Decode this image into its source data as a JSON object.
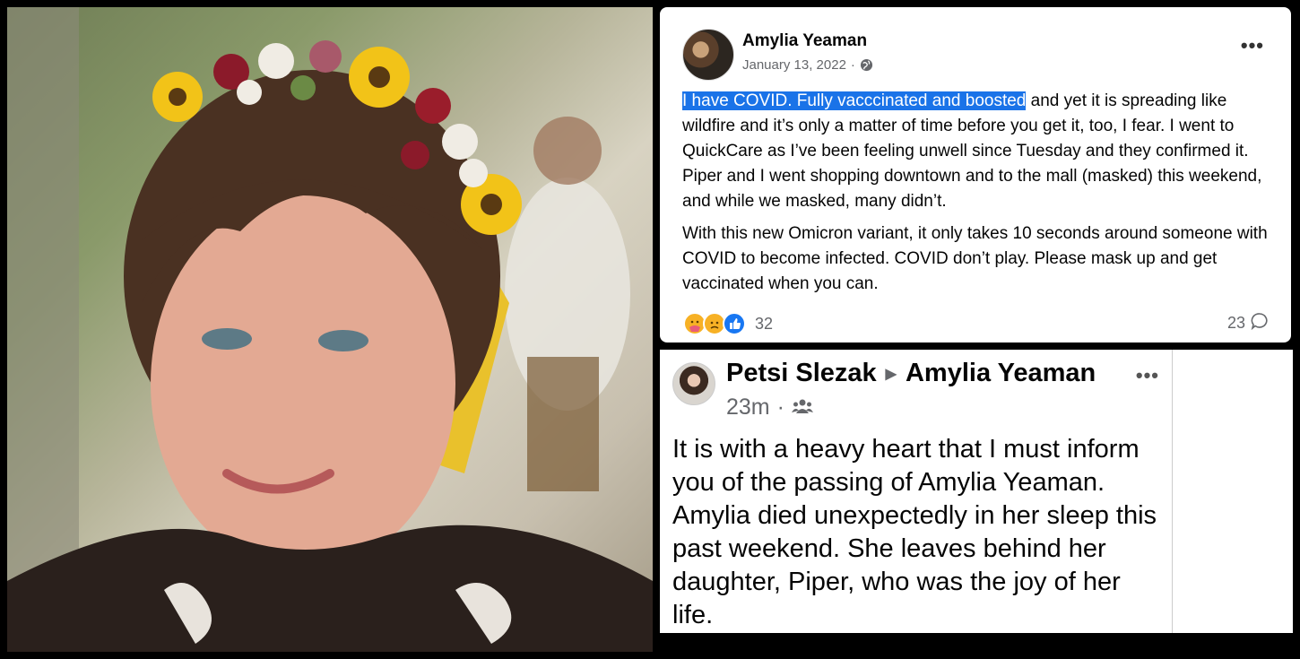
{
  "post1": {
    "author": "Amylia Yeaman",
    "date": "January 13, 2022",
    "date_sep": "·",
    "more": "•••",
    "highlighted": "I have COVID. Fully vacccinated and boosted",
    "para1_rest": " and yet it is spreading like wildfire and it’s only a matter of time before you get it, too, I fear. I went to QuickCare as I’ve been feeling  unwell since Tuesday and they confirmed it. Piper and I went shopping downtown and to the mall (masked) this weekend, and while we masked, many didn’t.",
    "para2": "With this new Omicron variant, it only takes 10 seconds around someone with COVID to become infected. COVID don’t play. Please mask up and get vaccinated when you can.",
    "reaction_count": "32",
    "comment_count": "23",
    "icons": [
      "globe-icon",
      "care-reaction-icon",
      "sad-reaction-icon",
      "like-reaction-icon",
      "comment-icon"
    ]
  },
  "post2": {
    "author": "Petsi Slezak",
    "arrow": "▶",
    "target": "Amylia Yeaman",
    "time": "23m",
    "time_sep": "·",
    "more": "•••",
    "body": "It is with a heavy heart that I must inform you of the passing of Amylia Yeaman. Amylia died unexpectedly in her sleep this past weekend.  She leaves behind her daughter, Piper, who was the joy of her life.",
    "icons": [
      "friends-icon"
    ]
  },
  "colors": {
    "background": "#000000",
    "highlight": "#1a73e8",
    "meta_text": "#65676b",
    "like_blue": "#1877f2"
  }
}
